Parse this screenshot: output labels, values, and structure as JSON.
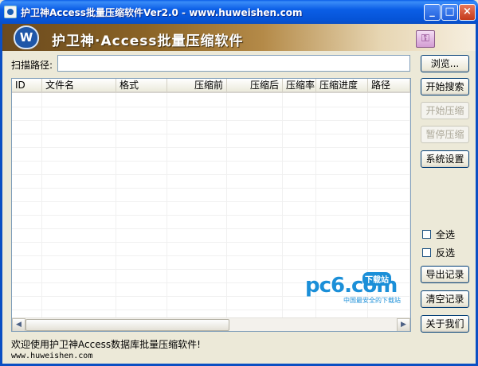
{
  "window": {
    "title": "护卫神Access批量压缩软件Ver2.0 - www.huweishen.com",
    "minimize_glyph": "_",
    "maximize_glyph": "□",
    "close_glyph": "×"
  },
  "banner": {
    "title": "护卫神·Access批量压缩软件",
    "logo_icon": "shield-logo-icon",
    "logo_glyph": "W",
    "key_icon": "key-icon",
    "key_glyph": "⚿"
  },
  "scan": {
    "label": "扫描路径:",
    "value": ""
  },
  "buttons": {
    "browse": "浏览...",
    "start_search": "开始搜索",
    "start_compress": "开始压缩",
    "pause_compress": "暂停压缩",
    "settings": "系统设置",
    "export_log": "导出记录",
    "clear_log": "清空记录",
    "about": "关于我们"
  },
  "table": {
    "columns": [
      "ID",
      "文件名",
      "格式",
      "压缩前",
      "压缩后",
      "压缩率",
      "压缩进度",
      "路径"
    ],
    "rows": []
  },
  "options": {
    "select_all": "全选",
    "invert_select": "反选"
  },
  "watermark": {
    "main": "pc6.com",
    "badge": "下载站",
    "sub": "中国最安全的下载站"
  },
  "status": {
    "welcome": "欢迎使用护卫神Access数据库批量压缩软件!",
    "website": "www.huweishen.com"
  },
  "scroll_glyphs": {
    "left": "◀",
    "right": "▶"
  }
}
